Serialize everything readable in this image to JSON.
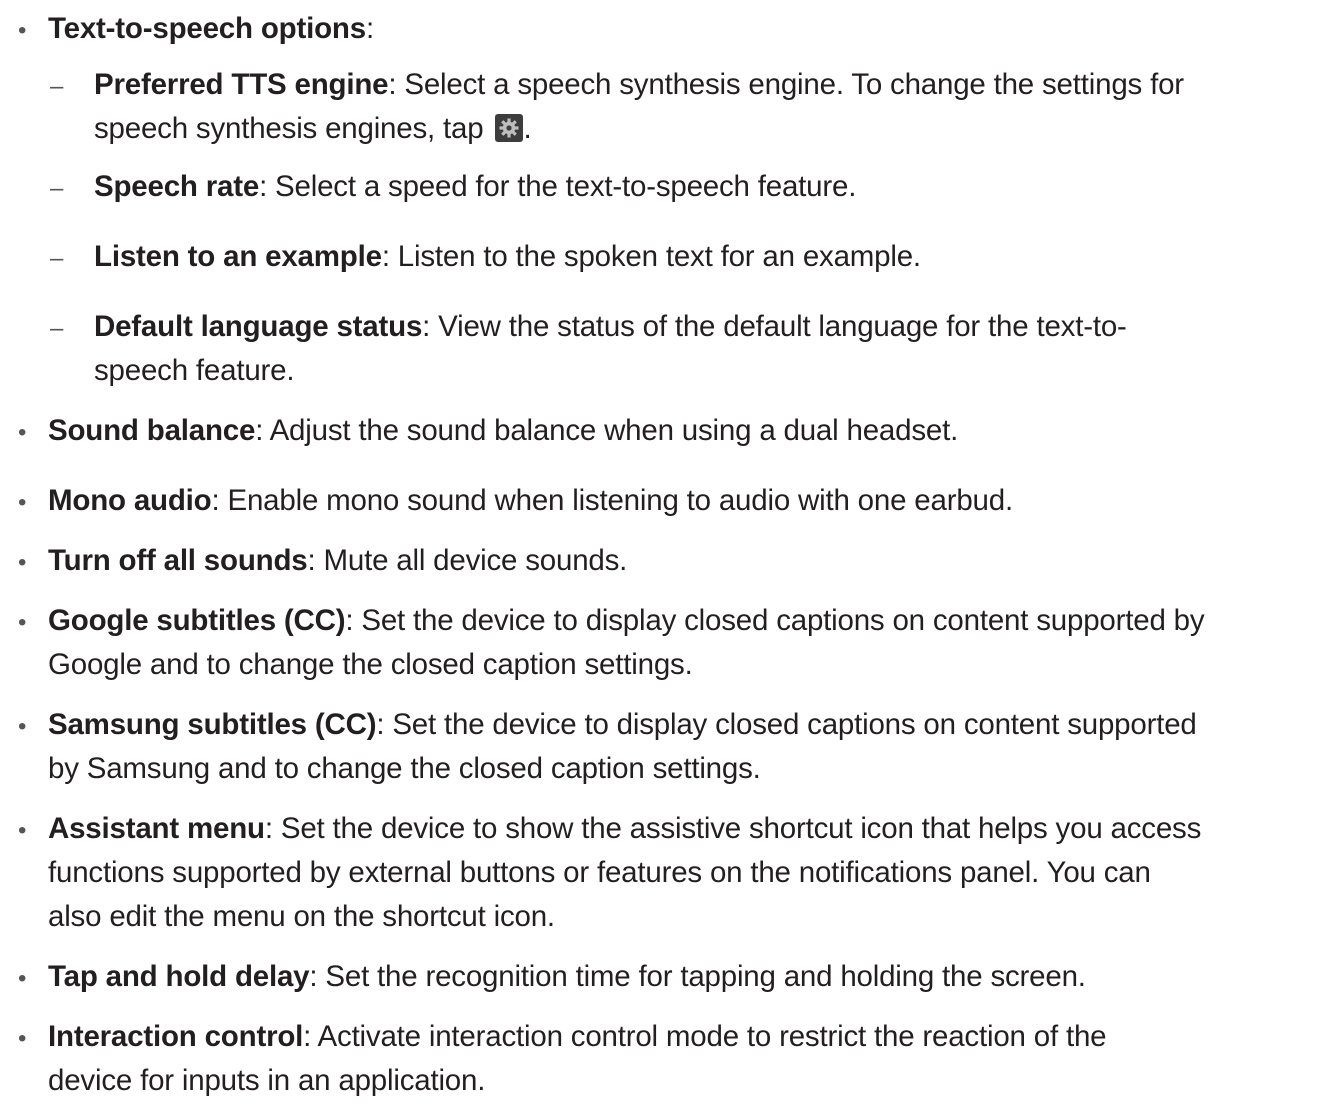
{
  "items": {
    "tts": {
      "term": "Text-to-speech options",
      "text": ":"
    },
    "tts_sub": [
      {
        "term": "Preferred TTS engine",
        "text_1": ": Select a speech synthesis engine. To change the settings for",
        "text_2": "speech synthesis engines, tap",
        "text_2_end": "."
      },
      {
        "term": "Speech rate",
        "text": ": Select a speed for the text-to-speech feature."
      },
      {
        "term": "Listen to an example",
        "text": ": Listen to the spoken text for an example."
      },
      {
        "term": "Default language status",
        "text_1": ": View the status of the default language for the text-to-",
        "text_2": "speech feature."
      }
    ],
    "sound_balance": {
      "term": "Sound balance",
      "text": ": Adjust the sound balance when using a dual headset."
    },
    "mono_audio": {
      "term": "Mono audio",
      "text": ": Enable mono sound when listening to audio with one earbud."
    },
    "turn_off": {
      "term": "Turn off all sounds",
      "text": ": Mute all device sounds."
    },
    "google_cc": {
      "term": "Google subtitles (CC)",
      "text_1": ": Set the device to display closed captions on content supported by",
      "text_2": "Google and to change the closed caption settings."
    },
    "samsung_cc": {
      "term": "Samsung subtitles (CC)",
      "text_1": ": Set the device to display closed captions on content supported",
      "text_2": "by Samsung and to change the closed caption settings."
    },
    "assistant": {
      "term": "Assistant menu",
      "text_1": ": Set the device to show the assistive shortcut icon that helps you access",
      "text_2": "functions supported by external buttons or features on the notifications panel. You can",
      "text_3": "also edit the menu on the shortcut icon."
    },
    "tap_hold": {
      "term": "Tap and hold delay",
      "text": ": Set the recognition time for tapping and holding the screen."
    },
    "interaction": {
      "term": "Interaction control",
      "text_1": ": Activate interaction control mode to restrict the reaction of the",
      "text_2": "device for inputs in an application."
    }
  },
  "markers": {
    "bullet": "•",
    "dash": "–"
  },
  "icons": {
    "settings": "gear-icon"
  },
  "colors": {
    "text": "#231f20",
    "icon_bg": "#3d3d3d"
  }
}
